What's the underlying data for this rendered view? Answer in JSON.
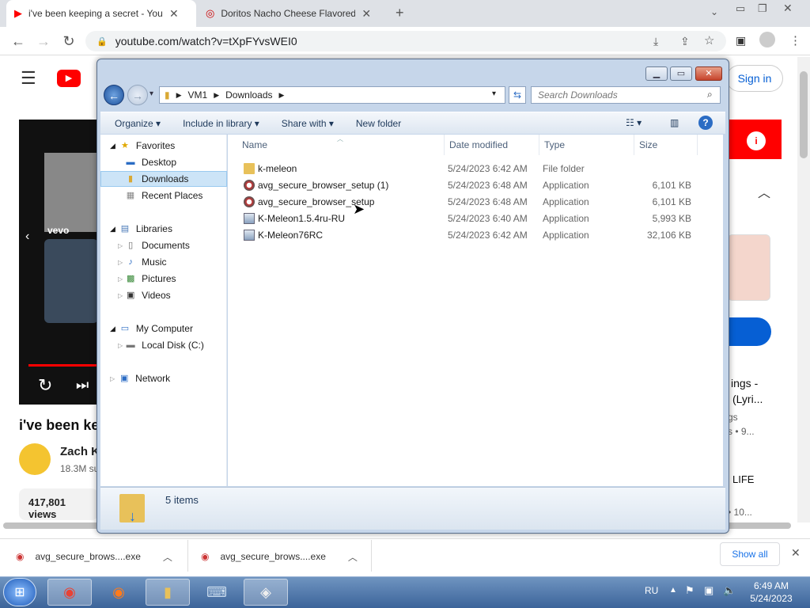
{
  "browser": {
    "tabs": [
      {
        "title": "i've been keeping a secret - YouT"
      },
      {
        "title": "Doritos Nacho Cheese Flavored T"
      }
    ],
    "url": "youtube.com/watch?v=tXpFYvsWEI0"
  },
  "youtube": {
    "sign_in": "Sign in",
    "video_title": "i've been kee",
    "channel": "Zach K",
    "subs": "18.3M su",
    "views": "417,801 views",
    "side1": "ings -",
    "side2": "(Lyri...",
    "side3": "gs",
    "side4": "s • 9...",
    "side5": "LIFE",
    "side6": "• 10...",
    "vevo": "vevo"
  },
  "explorer": {
    "breadcrumb": [
      "VM1",
      "Downloads"
    ],
    "search_placeholder": "Search Downloads",
    "commands": {
      "organize": "Organize",
      "include": "Include in library",
      "share": "Share with",
      "new_folder": "New folder"
    },
    "nav": {
      "favorites": "Favorites",
      "desktop": "Desktop",
      "downloads": "Downloads",
      "recent": "Recent Places",
      "libraries": "Libraries",
      "documents": "Documents",
      "music": "Music",
      "pictures": "Pictures",
      "videos": "Videos",
      "computer": "My Computer",
      "local_disk": "Local Disk (C:)",
      "network": "Network"
    },
    "columns": {
      "name": "Name",
      "date": "Date modified",
      "type": "Type",
      "size": "Size"
    },
    "files": [
      {
        "name": "k-meleon",
        "date": "5/24/2023 6:42 AM",
        "type": "File folder",
        "size": "",
        "icon": "folder-icon"
      },
      {
        "name": "avg_secure_browser_setup (1)",
        "date": "5/24/2023 6:48 AM",
        "type": "Application",
        "size": "6,101 KB",
        "icon": "avg-icon"
      },
      {
        "name": "avg_secure_browser_setup",
        "date": "5/24/2023 6:48 AM",
        "type": "Application",
        "size": "6,101 KB",
        "icon": "avg-icon"
      },
      {
        "name": "K-Meleon1.5.4ru-RU",
        "date": "5/24/2023 6:40 AM",
        "type": "Application",
        "size": "5,993 KB",
        "icon": "installer-icon"
      },
      {
        "name": "K-Meleon76RC",
        "date": "5/24/2023 6:42 AM",
        "type": "Application",
        "size": "32,106 KB",
        "icon": "installer-icon"
      }
    ],
    "status": "5 items"
  },
  "downloads": [
    {
      "name": "avg_secure_brows....exe"
    },
    {
      "name": "avg_secure_brows....exe"
    }
  ],
  "shelf": {
    "show_all": "Show all"
  },
  "taskbar": {
    "lang": "RU",
    "time": "6:49 AM",
    "date": "5/24/2023"
  },
  "colors": {
    "youtube_red": "#ff0000",
    "selection": "#cce4f7",
    "taskbar": "#3c649a"
  }
}
